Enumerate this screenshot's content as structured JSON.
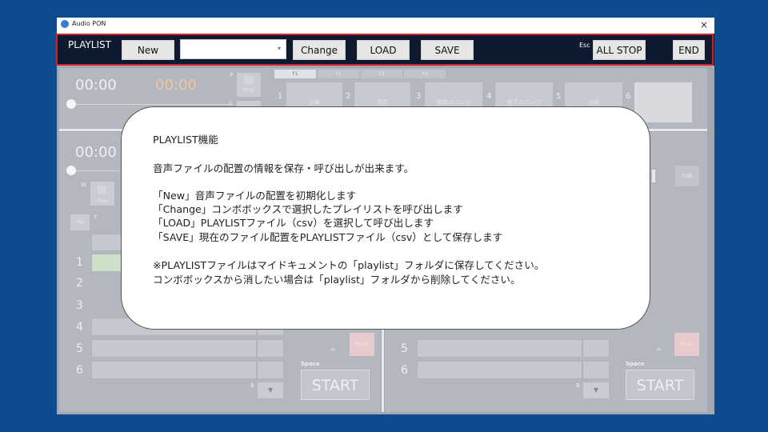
{
  "window": {
    "title": "Audio PON",
    "close_glyph": "×"
  },
  "toolbar": {
    "playlist_label": "PLAYLIST",
    "new_label": "New",
    "combo_value": "",
    "change_label": "Change",
    "load_label": "LOAD",
    "save_label": "SAVE",
    "esc_label": "Esc",
    "allstop_label": "ALL STOP",
    "end_label": "END"
  },
  "top_deck": {
    "time_current": "00:00",
    "time_remaining": "00:00",
    "p_label": "P",
    "stop_label": "Stop",
    "l_label": "L",
    "fkeys": [
      "F1",
      "F2",
      "F3",
      "F4"
    ],
    "slots": [
      {
        "num": "1",
        "label": "正解"
      },
      {
        "num": "2",
        "label": "残念"
      },
      {
        "num": "3",
        "label": "開始のゴング"
      },
      {
        "num": "4",
        "label": "終了のゴング"
      },
      {
        "num": "5",
        "label": "出囃"
      },
      {
        "num": "6",
        "label": ""
      }
    ]
  },
  "left_deck": {
    "time_current": "00:00",
    "w_label": "W",
    "stop_label": "Stop",
    "top_label": "Top",
    "t_label": "T",
    "row_numbers": [
      "1",
      "2",
      "3",
      "4",
      "5",
      "6"
    ],
    "b_label": "B",
    "down_arrow": "▼",
    "mute_label": "Mute",
    "space_label": "Space",
    "start_label": "START"
  },
  "right_deck": {
    "row_numbers": [
      "5",
      "6"
    ],
    "db_label": "0dB",
    "b_label": "B",
    "down_arrow": "▼",
    "mute_label": "Mute",
    "space_label": "Space",
    "start_label": "START"
  },
  "callout": {
    "title": "PLAYLIST機能",
    "intro": "音声ファイルの配置の情報を保存・呼び出しが出来ます。",
    "line_new": "「New」音声ファイルの配置を初期化します",
    "line_change": "「Change」コンボボックスで選択したプレイリストを呼び出します",
    "line_load": "「LOAD」PLAYLISTファイル（csv）を選択して呼び出します",
    "line_save": "「SAVE」現在のファイル配置をPLAYLISTファイル（csv）として保存します",
    "note_1": "※PLAYLISTファイルはマイドキュメントの「playlist」フォルダに保存してください。",
    "note_2": "コンボボックスから消したい場合は「playlist」フォルダから削除してください。"
  }
}
